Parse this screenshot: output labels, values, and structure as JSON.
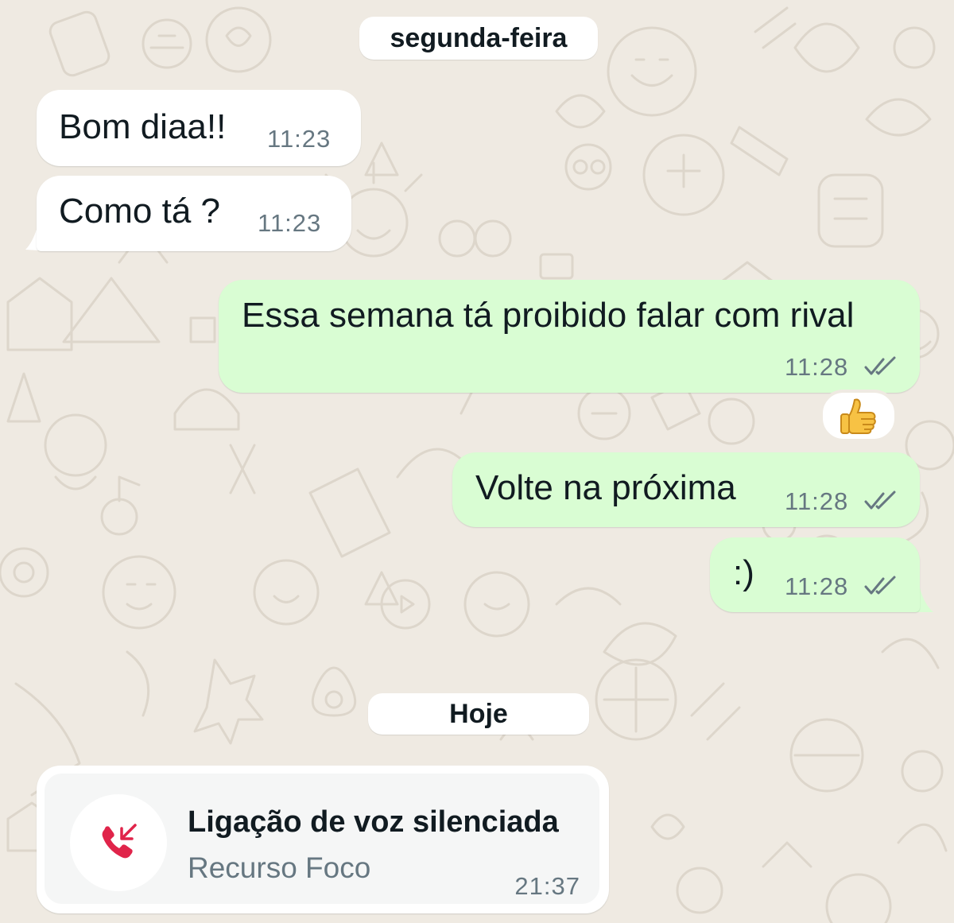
{
  "colors": {
    "background": "#efeae2",
    "incoming_bubble": "#ffffff",
    "outgoing_bubble": "#d9fdd3",
    "text_primary": "#111b21",
    "text_secondary": "#667781",
    "missed_call_red": "#e0244a"
  },
  "date_separators": [
    {
      "label": "segunda-feira"
    },
    {
      "label": "Hoje"
    }
  ],
  "messages": [
    {
      "direction": "incoming",
      "text": "Bom diaa!!",
      "time": "11:23"
    },
    {
      "direction": "incoming",
      "text": "Como tá ?",
      "time": "11:23"
    },
    {
      "direction": "outgoing",
      "text": "Essa semana tá proibido falar com rival",
      "time": "11:28",
      "status": "read",
      "reaction": "thumbs-up"
    },
    {
      "direction": "outgoing",
      "text": "Volte na próxima",
      "time": "11:28",
      "status": "read"
    },
    {
      "direction": "outgoing",
      "text": ":)",
      "time": "11:28",
      "status": "read"
    }
  ],
  "call_event": {
    "title": "Ligação de voz silenciada",
    "subtitle": "Recurso Foco",
    "time": "21:37",
    "icon": "missed-incoming-call-icon"
  }
}
